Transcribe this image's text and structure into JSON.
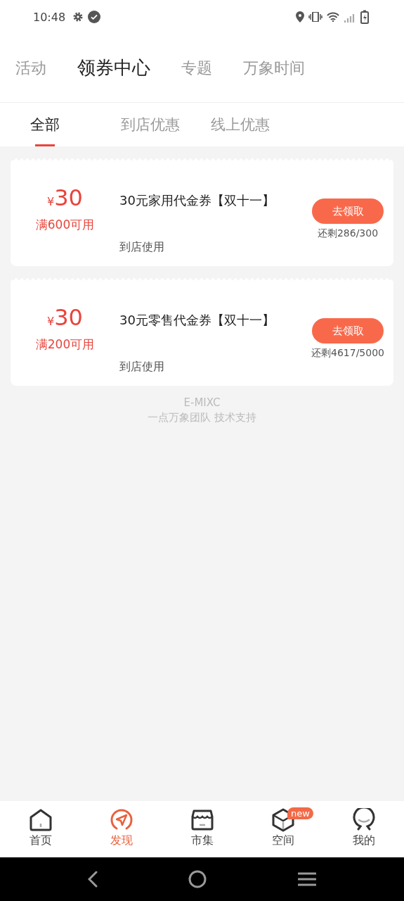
{
  "status_bar": {
    "time": "10:48"
  },
  "top_tabs": [
    {
      "label": "活动",
      "selected": false
    },
    {
      "label": "领券中心",
      "selected": true
    },
    {
      "label": "专题",
      "selected": false
    },
    {
      "label": "万象时间",
      "selected": false
    }
  ],
  "sub_tabs": [
    {
      "label": "全部",
      "selected": true
    },
    {
      "label": "到店优惠",
      "selected": false
    },
    {
      "label": "线上优惠",
      "selected": false
    }
  ],
  "coupons": [
    {
      "currency": "¥",
      "amount": "30",
      "threshold": "满600可用",
      "title": "30元家用代金券【双十一】",
      "usage": "到店使用",
      "button": "去领取",
      "remaining": "还剩286/300"
    },
    {
      "currency": "¥",
      "amount": "30",
      "threshold": "满200可用",
      "title": "30元零售代金券【双十一】",
      "usage": "到店使用",
      "button": "去领取",
      "remaining": "还剩4617/5000"
    }
  ],
  "footer": {
    "brand": "E-MIXC",
    "credit": "一点万象团队 技术支持"
  },
  "bottom_nav": [
    {
      "label": "首页",
      "selected": false
    },
    {
      "label": "发现",
      "selected": true
    },
    {
      "label": "市集",
      "selected": false
    },
    {
      "label": "空间",
      "selected": false,
      "badge": "new"
    },
    {
      "label": "我的",
      "selected": false
    }
  ]
}
